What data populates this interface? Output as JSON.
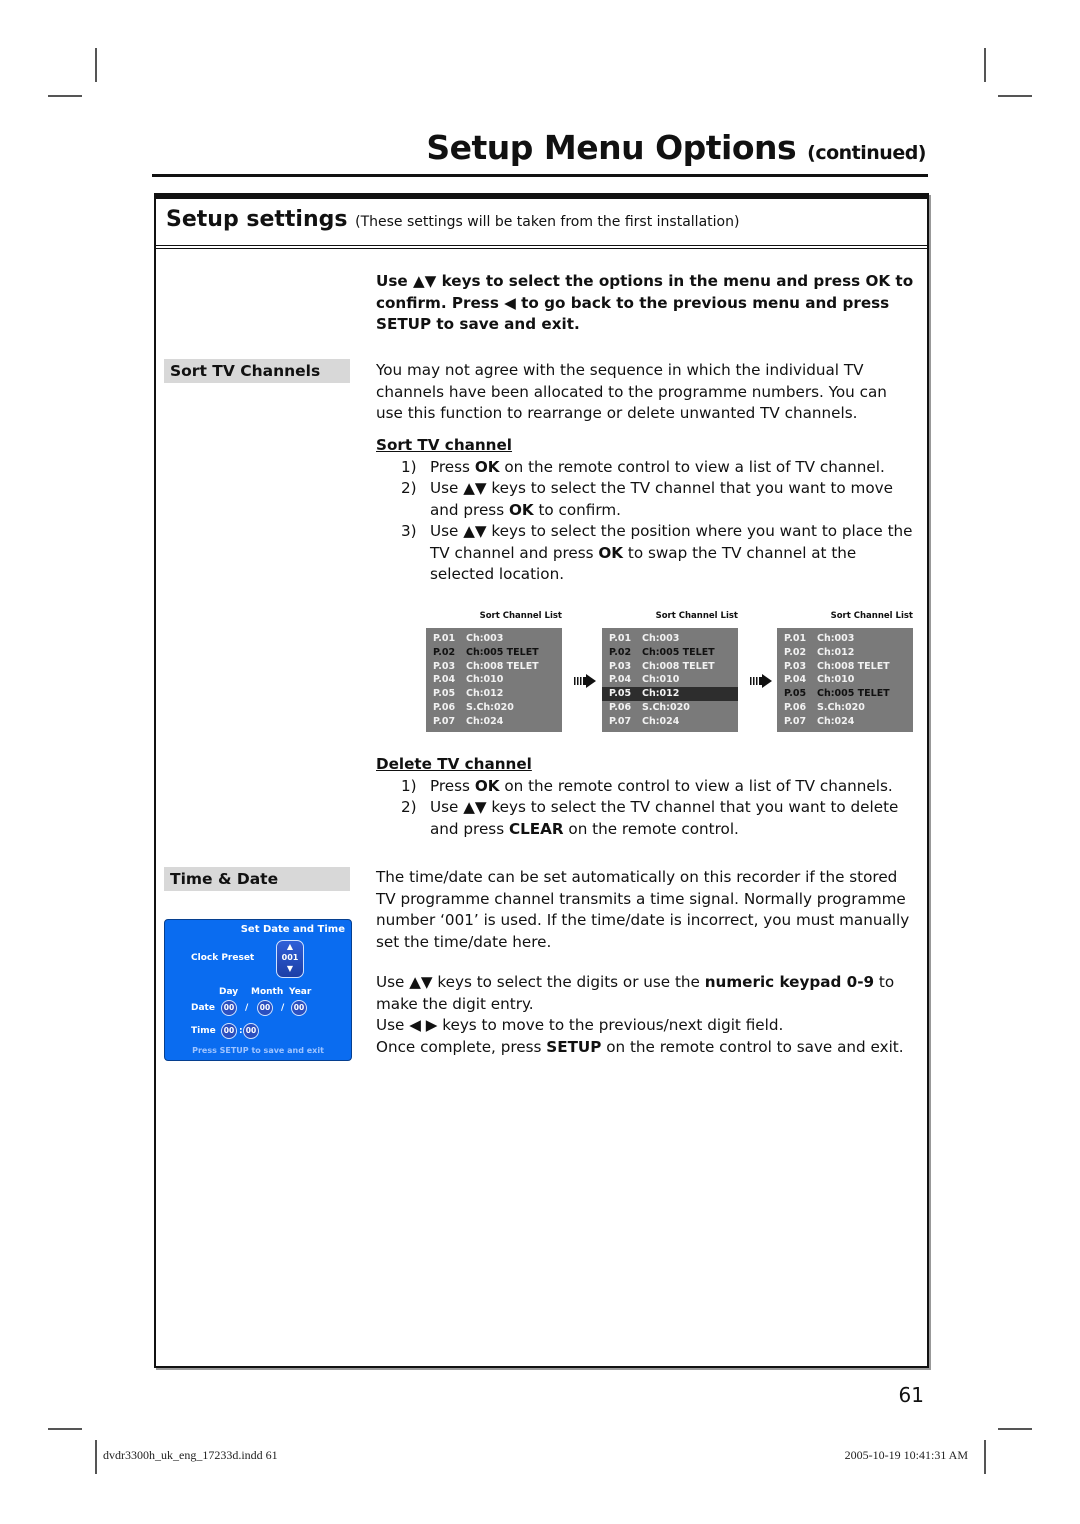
{
  "page": {
    "title": "Setup Menu Options",
    "title_suffix": "(continued)",
    "page_number": "61"
  },
  "section": {
    "heading": "Setup settings",
    "subheading": "(These settings will be taken from the first installation)"
  },
  "intro": {
    "line": "Use ▲▼ keys to select the options in the menu and press OK to confirm. Press ◀ to go back to the previous menu and press SETUP to save and exit."
  },
  "sort_tv_channels": {
    "label": "Sort TV Channels",
    "description": "You may not agree with the sequence in which the individual TV channels have been allocated to the programme numbers. You can use this function to rearrange or delete unwanted TV channels.",
    "sort_heading": "Sort TV channel",
    "sort_steps": [
      {
        "n": "1)",
        "pre": "Press ",
        "b": "OK",
        "post": " on the remote control to view a list of TV channel."
      },
      {
        "n": "2)",
        "pre": "Use ▲▼ keys to select the TV channel that you want to move and press ",
        "b": "OK",
        "post": " to confirm."
      },
      {
        "n": "3)",
        "pre": "Use ▲▼ keys to select the position where you want to place the TV channel and press ",
        "b": "OK",
        "post": " to swap the TV channel at the selected location."
      }
    ],
    "lists": [
      {
        "caption": "Sort Channel List",
        "rows": [
          {
            "p": "P.01",
            "ch": "Ch:003",
            "state": ""
          },
          {
            "p": "P.02",
            "ch": "Ch:005 TELET",
            "state": "dark"
          },
          {
            "p": "P.03",
            "ch": "Ch:008 TELET",
            "state": ""
          },
          {
            "p": "P.04",
            "ch": "Ch:010",
            "state": ""
          },
          {
            "p": "P.05",
            "ch": "Ch:012",
            "state": ""
          },
          {
            "p": "P.06",
            "ch": "S.Ch:020",
            "state": ""
          },
          {
            "p": "P.07",
            "ch": "Ch:024",
            "state": ""
          }
        ]
      },
      {
        "caption": "Sort Channel List",
        "rows": [
          {
            "p": "P.01",
            "ch": "Ch:003",
            "state": ""
          },
          {
            "p": "P.02",
            "ch": "Ch:005 TELET",
            "state": "dark"
          },
          {
            "p": "P.03",
            "ch": "Ch:008 TELET",
            "state": ""
          },
          {
            "p": "P.04",
            "ch": "Ch:010",
            "state": ""
          },
          {
            "p": "P.05",
            "ch": "Ch:012",
            "state": "hl"
          },
          {
            "p": "P.06",
            "ch": "S.Ch:020",
            "state": ""
          },
          {
            "p": "P.07",
            "ch": "Ch:024",
            "state": ""
          }
        ]
      },
      {
        "caption": "Sort Channel List",
        "rows": [
          {
            "p": "P.01",
            "ch": "Ch:003",
            "state": ""
          },
          {
            "p": "P.02",
            "ch": "Ch:012",
            "state": ""
          },
          {
            "p": "P.03",
            "ch": "Ch:008 TELET",
            "state": ""
          },
          {
            "p": "P.04",
            "ch": "Ch:010",
            "state": ""
          },
          {
            "p": "P.05",
            "ch": "Ch:005 TELET",
            "state": "dark"
          },
          {
            "p": "P.06",
            "ch": "S.Ch:020",
            "state": ""
          },
          {
            "p": "P.07",
            "ch": "Ch:024",
            "state": ""
          }
        ]
      }
    ],
    "arrow_icon": "striped-right-arrow",
    "delete_heading": "Delete TV channel",
    "delete_steps": [
      {
        "n": "1)",
        "pre": "Press ",
        "b": "OK",
        "post": " on the remote control to view a list of TV channels."
      },
      {
        "n": "2)",
        "pre": "Use ▲▼ keys to select the TV channel that you want to delete and press ",
        "b": "CLEAR",
        "post": " on the remote control."
      }
    ]
  },
  "time_date": {
    "label": "Time & Date",
    "para1": "The time/date can be set automatically on this recorder if the stored TV programme channel transmits a time signal. Normally programme number ‘001’ is used. If the time/date is incorrect, you must manually set the time/date here.",
    "para2_pre": "Use ▲▼ keys to select the digits or use the ",
    "para2_b": "numeric keypad 0-9",
    "para2_post": " to make the digit entry.",
    "para3": "Use ◀ ▶ keys to move to the previous/next digit field.",
    "para4_pre": "Once complete, press ",
    "para4_b": "SETUP",
    "para4_post": " on the remote control to save and exit.",
    "osd": {
      "title": "Set Date and Time",
      "clock_preset_label": "Clock Preset",
      "clock_preset_value": "001",
      "day_label": "Day",
      "month_label": "Month",
      "year_label": "Year",
      "date_label": "Date",
      "day_value": "00",
      "month_value": "00",
      "year_value": "00",
      "sep_date": "/",
      "time_label": "Time",
      "hour_value": "00",
      "minute_value": "00",
      "sep_time": ":",
      "footer": "Press SETUP to save and exit",
      "colors": {
        "background": "#0a6cf0",
        "footer_text": "#9fc4ff"
      }
    }
  },
  "slug": {
    "file": "dvdr3300h_uk_eng_17233d.indd   61",
    "timestamp": "2005-10-19   10:41:31 AM"
  }
}
